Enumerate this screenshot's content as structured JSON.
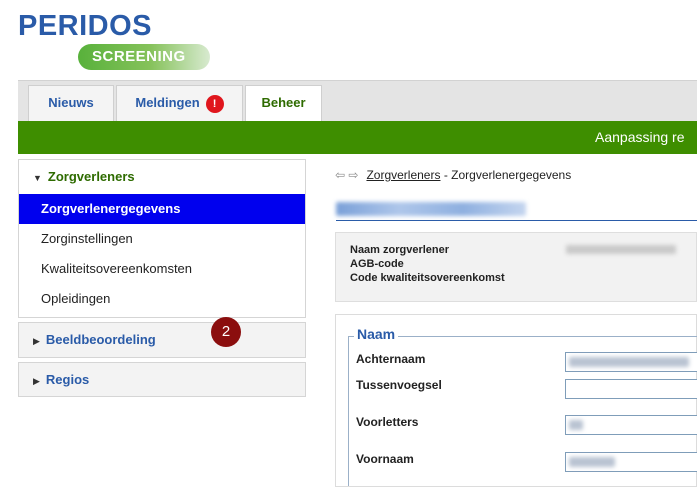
{
  "logo": {
    "title": "PERIDOS",
    "subtitle": "SCREENING"
  },
  "tabs": [
    {
      "label": "Nieuws"
    },
    {
      "label": "Meldingen",
      "badge": "!"
    },
    {
      "label": "Beheer"
    }
  ],
  "banner": {
    "text": "Aanpassing re"
  },
  "sidebar": {
    "sections": [
      {
        "label": "Zorgverleners",
        "items": [
          {
            "label": "Zorgverlenergegevens"
          },
          {
            "label": "Zorginstellingen"
          },
          {
            "label": "Kwaliteitsovereenkomsten"
          },
          {
            "label": "Opleidingen"
          }
        ]
      },
      {
        "label": "Beeldbeoordeling"
      },
      {
        "label": "Regios"
      }
    ],
    "marker": "2"
  },
  "breadcrumb": {
    "link": "Zorgverleners",
    "separator": " - ",
    "current": "Zorgverlenergegevens"
  },
  "info": {
    "labels": [
      "Naam zorgverlener",
      "AGB-code",
      "Code kwaliteitsovereenkomst"
    ]
  },
  "form": {
    "legend": "Naam",
    "fields": [
      {
        "label": "Achternaam"
      },
      {
        "label": "Tussenvoegsel"
      },
      {
        "label": "Voorletters"
      },
      {
        "label": "Voornaam"
      }
    ]
  },
  "colors": {
    "brand_blue": "#2a5ba8",
    "brand_green": "#3e8e00",
    "selection": "#0000ee",
    "badge_red": "#e0161d",
    "marker": "#8b0e0e"
  }
}
